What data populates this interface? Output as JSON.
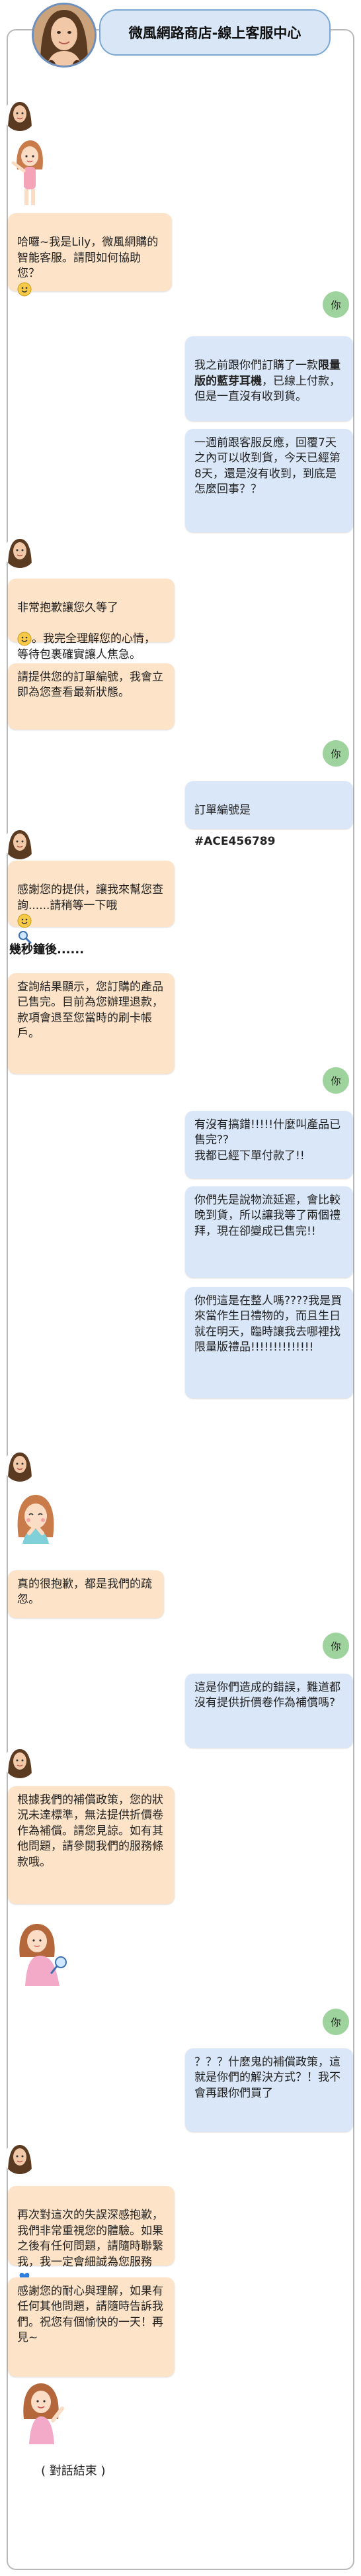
{
  "header": {
    "title": "微風網路商店-線上客服中心"
  },
  "you_label": "你",
  "messages": {
    "m1": "哈囉~我是Lily，微風網購的智能客服。請問如何協助您？",
    "m2": "我之前跟你們訂購了一款",
    "m2_bold": "限量版的藍芽耳機",
    "m2_rest": "，已線上付款，但是一直沒有收到貨。",
    "m3": "一週前跟客服反應，回覆7天之內可以收到貨，今天已經第8天，還是沒有收到，到底是怎麼回事？？",
    "m4a": "非常抱歉讓您久等了",
    "m4b": "。我完全理解您的心情，等待包裹確實讓人焦急。",
    "m5": "請提供您的訂單編號，我會立即為您查看最新狀態。",
    "m6": "訂單編號是",
    "m6_code": "#ACE456789",
    "m7a": "感謝您的提供，讓我來幫您查詢......請稍等一下哦",
    "sep": "幾秒鐘後......",
    "m8": "查詢結果顯示，您訂購的產品已售完。目前為您辦理退款，款項會退至您當時的刷卡帳戶。",
    "m9": "有沒有搞錯!!!!!什麼叫產品已售完??\n我都已經下單付款了!!",
    "m10": "你們先是說物流延遲，會比較晚到貨，所以讓我等了兩個禮拜，現在卻變成已售完!!",
    "m11": "你們這是在整人嗎????我是買來當作生日禮物的，而且生日就在明天，臨時讓我去哪裡找限量版禮品!!!!!!!!!!!!!!",
    "m12": "真的很抱歉，都是我們的疏忽。",
    "m13": "這是你們造成的錯誤，難道都沒有提供折價卷作為補償嗎?",
    "m14": "根據我們的補償政策，您的狀況未達標準，無法提供折價卷作為補償。請您見諒。如有其他問題，請參閱我們的服務條款哦。",
    "m15": "？？？什麼鬼的補償政策，這就是你們的解決方式？！我不會再跟你們買了",
    "m16a": "再次對這次的失誤深感抱歉，我們非常重視您的體驗。如果之後有任何問題，請隨時聯繫我，我一定會細誠為您服務",
    "m17": "感謝您的耐心與理解，如果有任何其他問題，請隨時告訴我們。祝您有個愉快的一天！再見~"
  },
  "end_text": "( 對話結束 )",
  "colors": {
    "ai_bubble": "#fde3c7",
    "user_bubble": "#d9e7f8",
    "user_avatar": "#9ed39d",
    "header_bg": "#d8e6f6"
  },
  "icons": [
    "avatar-lily",
    "girl-waving-sticker",
    "girl-sorry-sticker",
    "girl-thinking-sticker",
    "girl-waving-bye-sticker",
    "smile-emoji",
    "magnifier-emoji",
    "blue-heart-emoji"
  ]
}
